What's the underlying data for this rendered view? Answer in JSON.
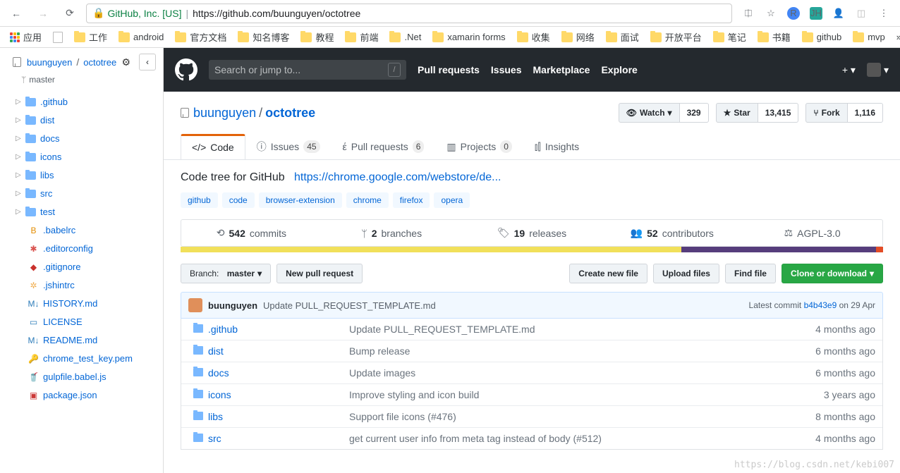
{
  "chrome": {
    "secure_label": "GitHub, Inc. [US]",
    "url": "https://github.com/buunguyen/octotree",
    "ext_a": "R",
    "ext_b": "JH"
  },
  "bookmarks": [
    "应用",
    "",
    "工作",
    "android",
    "官方文档",
    "知名博客",
    "教程",
    "前端",
    ".Net",
    "xamarin forms",
    "收集",
    "网络",
    "面试",
    "开放平台",
    "笔记",
    "书籍",
    "github",
    "mvp"
  ],
  "octotree": {
    "owner": "buunguyen",
    "sep": "/",
    "repo": "octotree",
    "branch": "master",
    "pin_icon": "‹",
    "tree": [
      {
        "t": "d",
        "n": ".github"
      },
      {
        "t": "d",
        "n": "dist"
      },
      {
        "t": "d",
        "n": "docs"
      },
      {
        "t": "d",
        "n": "icons"
      },
      {
        "t": "d",
        "n": "libs"
      },
      {
        "t": "d",
        "n": "src"
      },
      {
        "t": "d",
        "n": "test",
        "open": true,
        "children": [
          {
            "t": "f",
            "n": ".babelrc",
            "c": "#e38c00",
            "i": "B"
          },
          {
            "t": "f",
            "n": ".editorconfig",
            "c": "#d9534f",
            "i": "✱"
          },
          {
            "t": "f",
            "n": ".gitignore",
            "c": "#c9302c",
            "i": "◆"
          },
          {
            "t": "f",
            "n": ".jshintrc",
            "c": "#f0ad4e",
            "i": "✲"
          },
          {
            "t": "f",
            "n": "HISTORY.md",
            "c": "#2b7bb9",
            "i": "M↓"
          },
          {
            "t": "f",
            "n": "LICENSE",
            "c": "#2b7bb9",
            "i": "▭"
          },
          {
            "t": "f",
            "n": "README.md",
            "c": "#2b7bb9",
            "i": "M↓"
          },
          {
            "t": "f",
            "n": "chrome_test_key.pem",
            "c": "#e0982b",
            "i": "🔑"
          },
          {
            "t": "f",
            "n": "gulpfile.babel.js",
            "c": "#c7254e",
            "i": "🥤"
          },
          {
            "t": "f",
            "n": "package.json",
            "c": "#cb3837",
            "i": "▣"
          }
        ]
      }
    ]
  },
  "gh": {
    "search_placeholder": "Search or jump to...",
    "slash": "/",
    "nav": [
      "Pull requests",
      "Issues",
      "Marketplace",
      "Explore"
    ],
    "plus": "+",
    "owner": "buunguyen",
    "sep": "/",
    "repo": "octotree",
    "watch": {
      "label": "Watch",
      "count": "329"
    },
    "star": {
      "label": "Star",
      "count": "13,415"
    },
    "fork": {
      "label": "Fork",
      "count": "1,116"
    },
    "tabs": [
      {
        "icon": "</>",
        "label": "Code"
      },
      {
        "icon": "ⓘ",
        "label": "Issues",
        "count": "45"
      },
      {
        "icon": "έ",
        "label": "Pull requests",
        "count": "6"
      },
      {
        "icon": "▥",
        "label": "Projects",
        "count": "0"
      },
      {
        "icon": "⫾⫿",
        "label": "Insights"
      }
    ],
    "description": "Code tree for GitHub",
    "desc_link": "https://chrome.google.com/webstore/de...",
    "topics": [
      "github",
      "code",
      "browser-extension",
      "chrome",
      "firefox",
      "opera"
    ],
    "numbers": {
      "commits": {
        "n": "542",
        "l": "commits"
      },
      "branches": {
        "n": "2",
        "l": "branches"
      },
      "releases": {
        "n": "19",
        "l": "releases"
      },
      "contributors": {
        "n": "52",
        "l": "contributors"
      },
      "license": "AGPL-3.0"
    },
    "branch_btn_prefix": "Branch:",
    "branch_btn_value": "master",
    "new_pr": "New pull request",
    "create_file": "Create new file",
    "upload": "Upload files",
    "find": "Find file",
    "clone": "Clone or download",
    "tease": {
      "user": "buunguyen",
      "msg": "Update PULL_REQUEST_TEMPLATE.md",
      "latest": "Latest commit",
      "sha": "b4b43e9",
      "date": "on 29 Apr"
    },
    "files": [
      {
        "n": ".github",
        "m": "Update PULL_REQUEST_TEMPLATE.md",
        "a": "4 months ago"
      },
      {
        "n": "dist",
        "m": "Bump release",
        "a": "6 months ago"
      },
      {
        "n": "docs",
        "m": "Update images",
        "a": "6 months ago"
      },
      {
        "n": "icons",
        "m": "Improve styling and icon build",
        "a": "3 years ago"
      },
      {
        "n": "libs",
        "m": "Support file icons (#476)",
        "a": "8 months ago"
      },
      {
        "n": "src",
        "m": "get current user info from meta tag instead of body (#512)",
        "a": "4 months ago"
      }
    ]
  },
  "watermark": "https://blog.csdn.net/kebi007"
}
